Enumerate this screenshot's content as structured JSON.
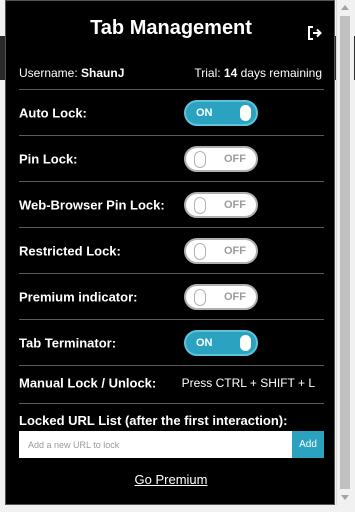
{
  "header": {
    "title": "Tab Management",
    "logout_icon": "logout-icon"
  },
  "user": {
    "username_label": "Username:",
    "username": "ShaunJ",
    "trial_prefix": "Trial:",
    "trial_days": "14",
    "trial_suffix": "days remaining"
  },
  "settings": [
    {
      "label": "Auto Lock:",
      "state": "ON",
      "enabled": true
    },
    {
      "label": "Pin Lock:",
      "state": "OFF",
      "enabled": false
    },
    {
      "label": "Web-Browser Pin Lock:",
      "state": "OFF",
      "enabled": false
    },
    {
      "label": "Restricted Lock:",
      "state": "OFF",
      "enabled": false
    },
    {
      "label": "Premium indicator:",
      "state": "OFF",
      "enabled": false
    },
    {
      "label": "Tab Terminator:",
      "state": "ON",
      "enabled": true
    }
  ],
  "manual_lock": {
    "label": "Manual Lock / Unlock:",
    "shortcut": "Press CTRL + SHIFT + L"
  },
  "url_list": {
    "title": "Locked URL List (after the first interaction):",
    "placeholder": "Add a new URL to lock",
    "value": "",
    "add_label": "Add"
  },
  "footer": {
    "premium_link": "Go Premium"
  },
  "colors": {
    "accent": "#2ba3c0",
    "background": "#000000",
    "divider": "#5a5a5a"
  }
}
